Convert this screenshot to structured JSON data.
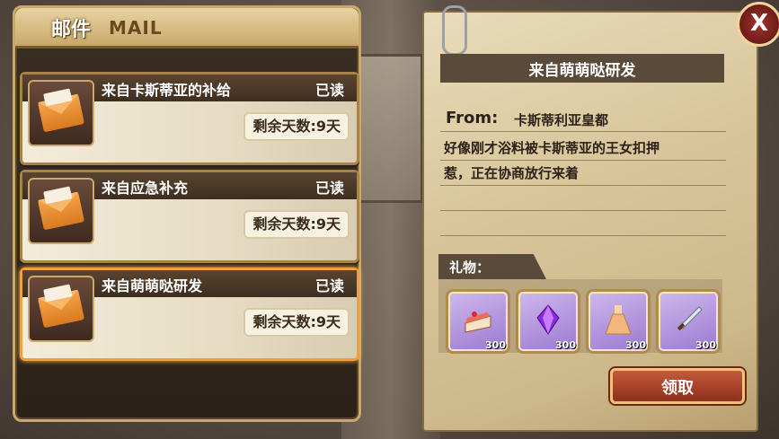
{
  "mail_panel": {
    "title": "邮件",
    "title_en": "MAIL",
    "items": [
      {
        "subject": "来自卡斯蒂亚的补给",
        "status": "已读",
        "days_left": "剩余天数:9天",
        "icon": "envelope-icon"
      },
      {
        "subject": "来自应急补充",
        "status": "已读",
        "days_left": "剩余天数:9天",
        "icon": "envelope-icon"
      },
      {
        "subject": "来自萌萌哒研发",
        "status": "已读",
        "days_left": "剩余天数:9天",
        "icon": "envelope-icon",
        "selected": true
      }
    ]
  },
  "letter": {
    "title": "来自萌萌哒研发",
    "from_label": "From:",
    "from_value": "卡斯蒂利亚皇都",
    "body_line1": "好像刚才浴料被卡斯蒂亚的王女扣押",
    "body_line2": "惹，正在协商放行来着",
    "gift_label": "礼物：",
    "gifts": [
      {
        "icon": "cake-icon",
        "qty": "300"
      },
      {
        "icon": "crystal-icon",
        "qty": "300"
      },
      {
        "icon": "dress-icon",
        "qty": "300"
      },
      {
        "icon": "dagger-icon",
        "qty": "300"
      }
    ],
    "claim_label": "领取"
  },
  "close_label": "X"
}
